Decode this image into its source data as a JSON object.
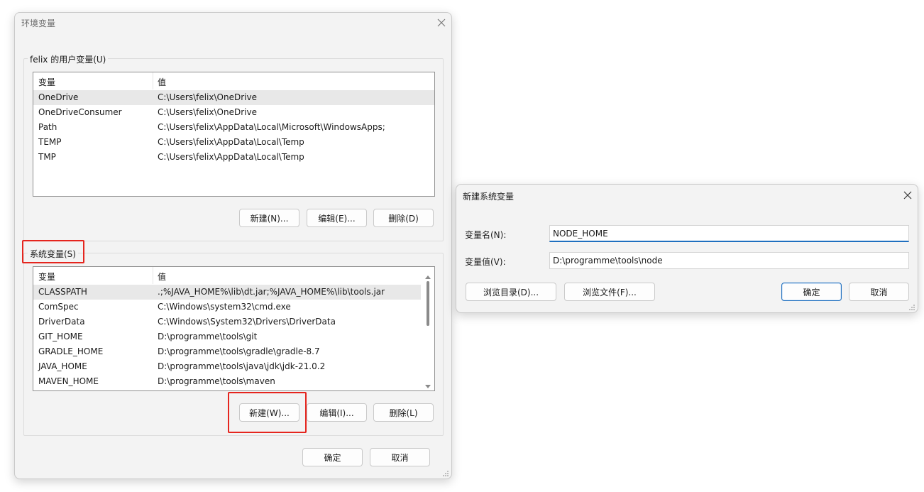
{
  "env_dialog": {
    "title": "环境变量",
    "user_group_label": "felix 的用户变量(U)",
    "sys_group_label": "系统变量(S)",
    "col_variable": "变量",
    "col_value": "值",
    "user_vars": [
      {
        "name": "OneDrive",
        "value": "C:\\Users\\felix\\OneDrive"
      },
      {
        "name": "OneDriveConsumer",
        "value": "C:\\Users\\felix\\OneDrive"
      },
      {
        "name": "Path",
        "value": "C:\\Users\\felix\\AppData\\Local\\Microsoft\\WindowsApps;"
      },
      {
        "name": "TEMP",
        "value": "C:\\Users\\felix\\AppData\\Local\\Temp"
      },
      {
        "name": "TMP",
        "value": "C:\\Users\\felix\\AppData\\Local\\Temp"
      }
    ],
    "sys_vars": [
      {
        "name": "CLASSPATH",
        "value": ".;%JAVA_HOME%\\lib\\dt.jar;%JAVA_HOME%\\lib\\tools.jar"
      },
      {
        "name": "ComSpec",
        "value": "C:\\Windows\\system32\\cmd.exe"
      },
      {
        "name": "DriverData",
        "value": "C:\\Windows\\System32\\Drivers\\DriverData"
      },
      {
        "name": "GIT_HOME",
        "value": "D:\\programme\\tools\\git"
      },
      {
        "name": "GRADLE_HOME",
        "value": "D:\\programme\\tools\\gradle\\gradle-8.7"
      },
      {
        "name": "JAVA_HOME",
        "value": "D:\\programme\\tools\\java\\jdk\\jdk-21.0.2"
      },
      {
        "name": "MAVEN_HOME",
        "value": "D:\\programme\\tools\\maven"
      }
    ],
    "user_buttons": {
      "new": "新建(N)...",
      "edit": "编辑(E)...",
      "delete": "删除(D)"
    },
    "sys_buttons": {
      "new": "新建(W)...",
      "edit": "编辑(I)...",
      "delete": "删除(L)"
    },
    "ok": "确定",
    "cancel": "取消"
  },
  "new_var_dialog": {
    "title": "新建系统变量",
    "name_label": "变量名(N):",
    "value_label": "变量值(V):",
    "name_value": "NODE_HOME",
    "value_value": "D:\\programme\\tools\\node",
    "browse_dir": "浏览目录(D)...",
    "browse_file": "浏览文件(F)...",
    "ok": "确定",
    "cancel": "取消"
  },
  "colors": {
    "highlight": "#e5251e",
    "accent": "#1f6fbf"
  }
}
